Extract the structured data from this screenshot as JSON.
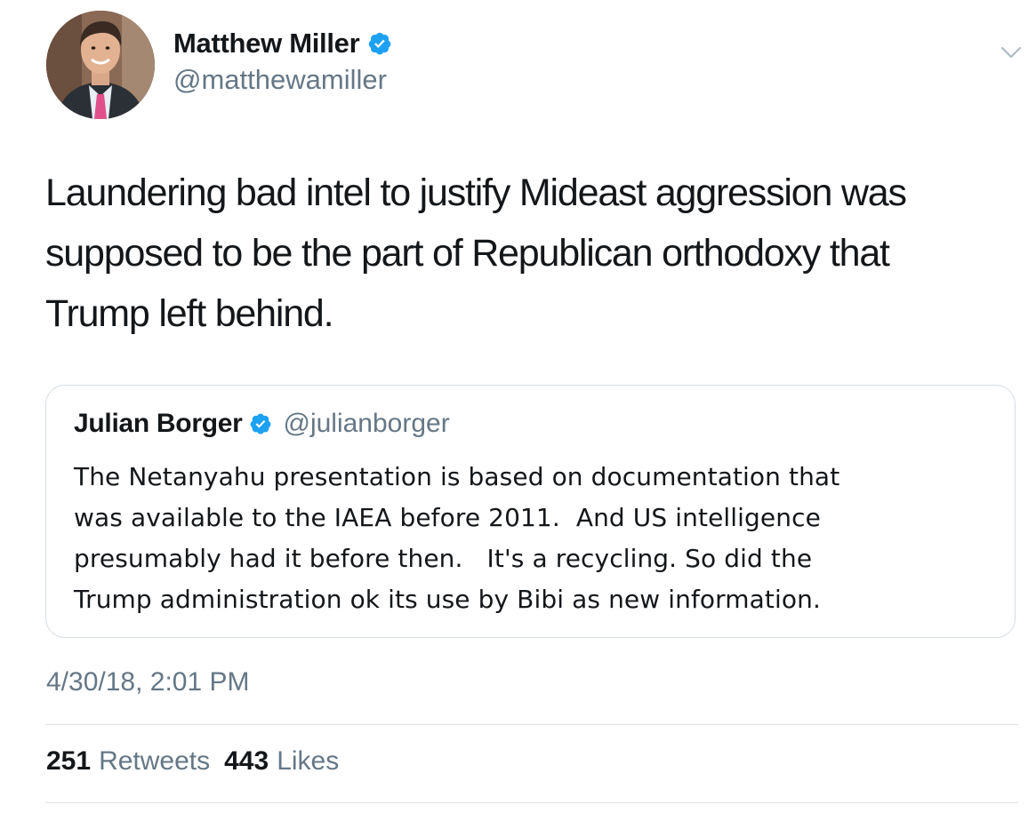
{
  "tweet": {
    "author": {
      "name": "Matthew Miller",
      "handle": "@matthewamiller",
      "verified": true
    },
    "text": "Laundering bad intel to justify Mideast aggression was\nsupposed to be the part of Republican orthodoxy that\nTrump left behind.",
    "quoted_tweet": {
      "author_name": "Julian Borger",
      "author_handle": "@julianborger",
      "verified": true,
      "text": "The Netanyahu presentation is based on documentation that\nwas available to the IAEA before 2011.  And US intelligence\npresumably had it before then.   It's a recycling. So did the\nTrump administration ok its use by Bibi as new information."
    },
    "timestamp": "4/30/18, 2:01 PM",
    "stats": {
      "retweets_count": "251",
      "retweets_label": "Retweets",
      "likes_count": "443",
      "likes_label": "Likes"
    }
  },
  "icons": {
    "verified": "verified-badge-icon",
    "menu": "chevron-down-icon"
  },
  "colors": {
    "verified_blue": "#1da1f2",
    "secondary_text": "#657786",
    "primary_text": "#14171a",
    "border": "#d5dde3"
  }
}
